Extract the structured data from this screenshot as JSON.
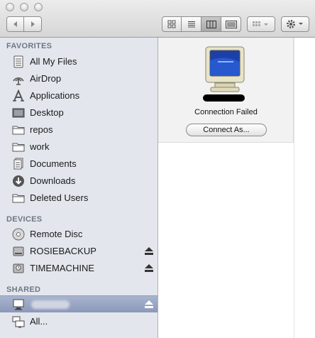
{
  "sidebar": {
    "favorites_header": "FAVORITES",
    "devices_header": "DEVICES",
    "shared_header": "SHARED",
    "favorites": [
      {
        "label": "All My Files",
        "icon": "all-files-icon"
      },
      {
        "label": "AirDrop",
        "icon": "airdrop-icon"
      },
      {
        "label": "Applications",
        "icon": "applications-icon"
      },
      {
        "label": "Desktop",
        "icon": "desktop-icon"
      },
      {
        "label": "repos",
        "icon": "folder-icon"
      },
      {
        "label": "work",
        "icon": "folder-icon"
      },
      {
        "label": "Documents",
        "icon": "documents-icon"
      },
      {
        "label": "Downloads",
        "icon": "downloads-icon"
      },
      {
        "label": "Deleted Users",
        "icon": "folder-icon"
      }
    ],
    "devices": [
      {
        "label": "Remote Disc",
        "icon": "disc-icon"
      },
      {
        "label": "ROSIEBACKUP",
        "icon": "drive-icon"
      },
      {
        "label": "TIMEMACHINE",
        "icon": "timemachine-drive-icon"
      }
    ],
    "shared": [
      {
        "label": "",
        "icon": "computer-icon"
      },
      {
        "label": "All...",
        "icon": "network-icon"
      }
    ]
  },
  "main": {
    "status": "Connection Failed",
    "connect_button": "Connect As..."
  },
  "colors": {
    "sidebar_bg": "#e3e7ed",
    "selection": "#8b98b8",
    "section_header": "#6e7782"
  }
}
